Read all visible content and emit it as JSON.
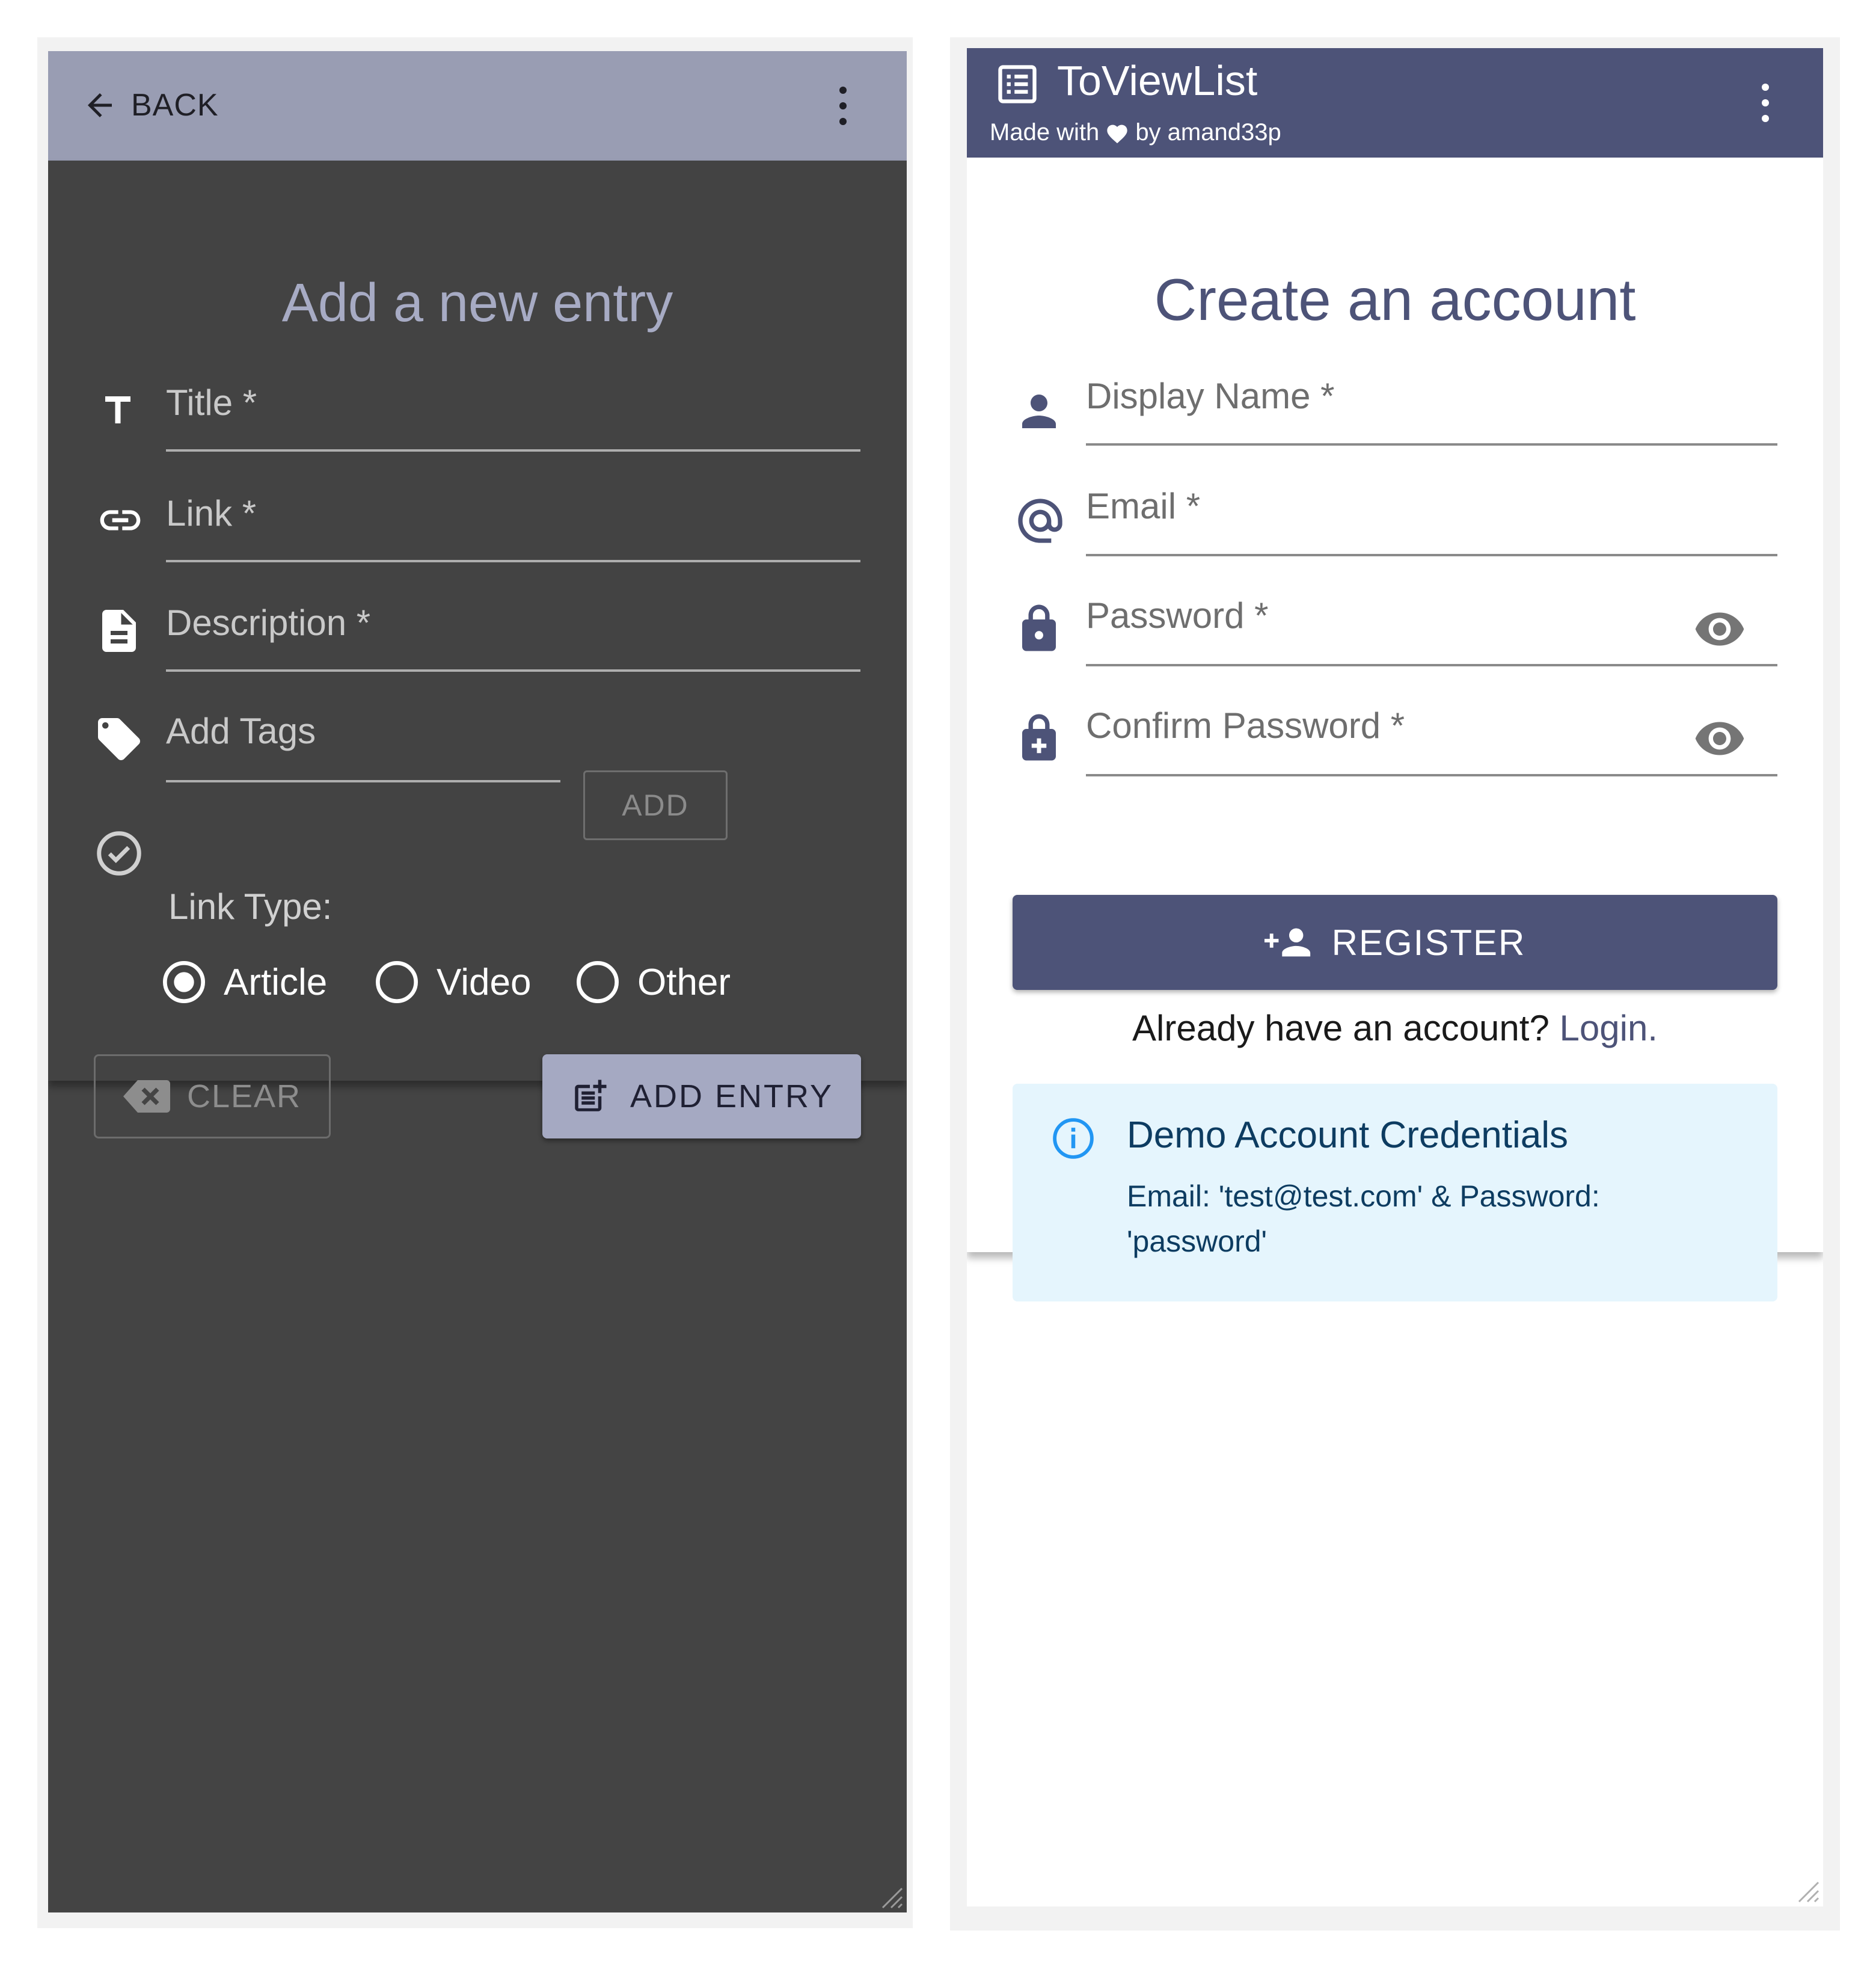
{
  "add_entry_screen": {
    "app_bar": {
      "back_label": "BACK"
    },
    "form": {
      "title": "Add a new entry",
      "title_placeholder": "Title *",
      "link_placeholder": "Link *",
      "description_placeholder": "Description *",
      "tags_placeholder": "Add Tags",
      "add_tag_label": "ADD",
      "link_type_label": "Link Type:",
      "link_type_options": [
        "Article",
        "Video",
        "Other"
      ],
      "link_type_selected": "Article",
      "clear_label": "CLEAR",
      "add_entry_label": "ADD ENTRY"
    },
    "colors": {
      "background": "#444444",
      "app_bar": "#999db3",
      "accent": "#a5a9c2"
    }
  },
  "register_screen": {
    "app_bar": {
      "title": "ToViewList",
      "subtitle_prefix": "Made with",
      "subtitle_suffix": "by amand33p"
    },
    "form": {
      "title": "Create an account",
      "display_name_placeholder": "Display Name *",
      "email_placeholder": "Email *",
      "password_placeholder": "Password *",
      "confirm_password_placeholder": "Confirm Password *",
      "register_label": "REGISTER",
      "login_prompt": "Already have an account?",
      "login_link": "Login."
    },
    "demo_alert": {
      "title": "Demo Account Credentials",
      "body": "Email: 'test@test.com' & Password: 'password'"
    },
    "icons": [
      "list-icon",
      "heart-icon",
      "person-icon",
      "at-icon",
      "lock-icon",
      "lock-plus-icon",
      "eye-icon",
      "person-add-icon",
      "info-icon",
      "more-vert-icon"
    ],
    "colors": {
      "app_bar": "#4d5378",
      "accent": "#4d5378",
      "alert_bg": "#e5f5fd",
      "alert_text": "#0d3c61"
    }
  }
}
